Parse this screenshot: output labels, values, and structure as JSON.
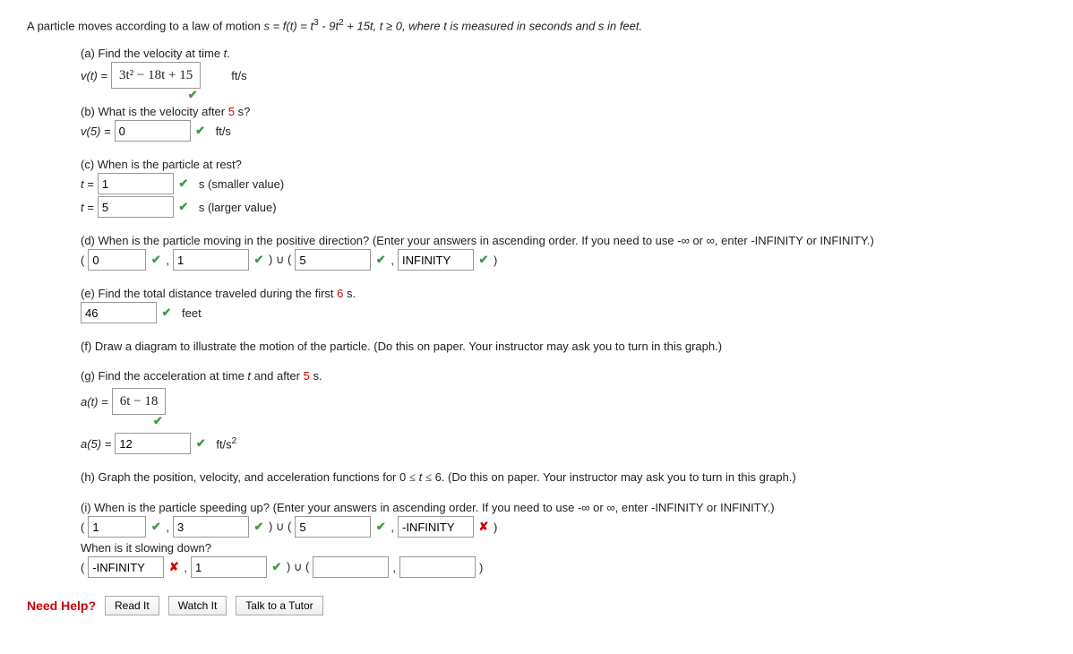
{
  "question": {
    "intro_pre": "A particle moves according to a law of motion ",
    "intro_eq": "s = f(t) = t",
    "intro_eq2": " - 9t",
    "intro_eq3": " + 15t, t ≥ 0, where t is measured in seconds and s in feet."
  },
  "a": {
    "label": "(a) Find the velocity at time ",
    "label_var": "t",
    "label_end": ".",
    "lhs": "v(t) = ",
    "answer": "3t² − 18t + 15",
    "unit": "ft/s"
  },
  "b": {
    "label_pre": "(b) What is the velocity after ",
    "label_red": "5",
    "label_post": " s?",
    "lhs": "v(5) = ",
    "answer": "0",
    "unit": "ft/s"
  },
  "c": {
    "label": "(c) When is the particle at rest?",
    "row1_lhs": "t = ",
    "row1_val": "1",
    "row1_unit": "s (smaller value)",
    "row2_lhs": "t = ",
    "row2_val": "5",
    "row2_unit": "s (larger value)"
  },
  "d": {
    "label": "(d) When is the particle moving in the positive direction? (Enter your answers in ascending order. If you need to use -∞ or ∞, enter -INFINITY or INFINITY.)",
    "lp": "(",
    "v1": "0",
    "comma": ",",
    "v2": "1",
    "mid": ") ∪ (",
    "v3": "5",
    "v4": "INFINITY",
    "rp": ")"
  },
  "e": {
    "label_pre": "(e) Find the total distance traveled during the first ",
    "label_red": "6",
    "label_post": " s.",
    "val": "46",
    "unit": "feet"
  },
  "f": {
    "label": "(f) Draw a diagram to illustrate the motion of the particle. (Do this on paper. Your instructor may ask you to turn in this graph.)"
  },
  "g": {
    "label_pre": "(g) Find the acceleration at time ",
    "label_var": "t",
    "label_mid": " and after ",
    "label_red": "5",
    "label_post": " s.",
    "lhs1": "a(t) = ",
    "ans1": "6t − 18",
    "lhs2": "a(5) = ",
    "ans2": "12",
    "unit2": "ft/s²"
  },
  "h": {
    "label_pre": "(h) Graph the position, velocity, and acceleration functions for 0 ",
    "label_mid": " t ",
    "label_post": " 6. (Do this on paper. Your instructor may ask you to turn in this graph.)"
  },
  "i": {
    "label": "(i) When is the particle speeding up? (Enter your answers in ascending order. If you need to use -∞ or ∞, enter -INFINITY or INFINITY.)",
    "lp": "(",
    "v1": "1",
    "comma": ",",
    "v2": "3",
    "mid": ") ∪ (",
    "v3": "5",
    "v4": "-INFINITY",
    "rp": ")",
    "slow_label": "When is it slowing down?",
    "s1": "-INFINITY",
    "s2": "1",
    "s3": "",
    "s4": ""
  },
  "help": {
    "label": "Need Help?",
    "read": "Read It",
    "watch": "Watch It",
    "tutor": "Talk to a Tutor"
  }
}
